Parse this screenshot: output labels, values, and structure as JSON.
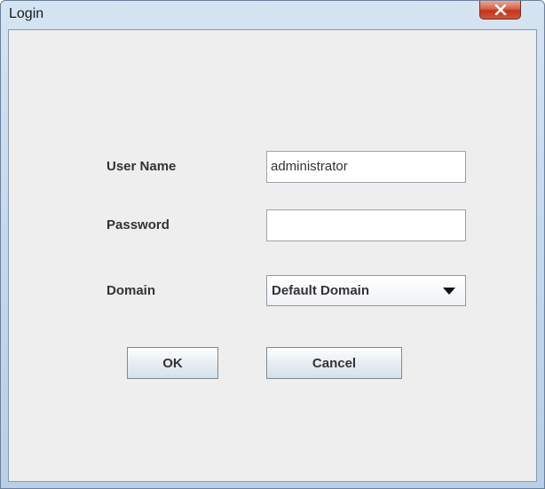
{
  "window": {
    "title": "Login",
    "close_label": "x"
  },
  "form": {
    "username_label": "User Name",
    "username_value": "administrator",
    "password_label": "Password",
    "password_value": "",
    "domain_label": "Domain",
    "domain_value": "Default Domain"
  },
  "buttons": {
    "ok_label": "OK",
    "cancel_label": "Cancel"
  },
  "icons": {
    "close": "close-icon",
    "dropdown": "chevron-down-icon"
  },
  "colors": {
    "close_button": "#c4351b",
    "dialog_background": "#eeeeee",
    "window_frame": "#c4d8ee"
  }
}
